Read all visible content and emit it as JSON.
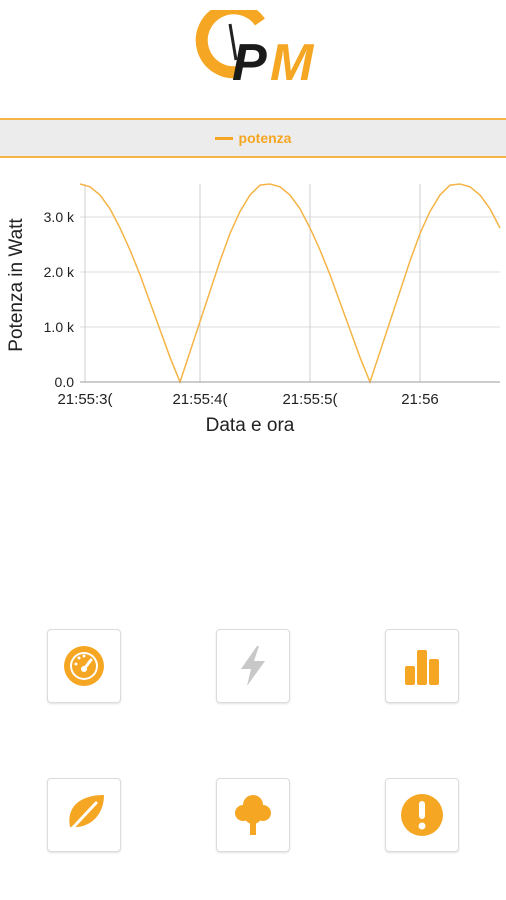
{
  "app": {
    "logo_text": "PM"
  },
  "legend": {
    "label": "potenza"
  },
  "chart_data": {
    "type": "line",
    "xlabel": "Data e ora",
    "ylabel": "Potenza in Watt",
    "x_ticks": [
      "21:55:3(",
      "21:55:4(",
      "21:55:5(",
      "21:56"
    ],
    "y_ticks": [
      "0.0",
      "1.0 k",
      "2.0 k",
      "3.0 k"
    ],
    "ylim": [
      0,
      3600
    ],
    "grid": true,
    "series": [
      {
        "name": "potenza",
        "color": "#f5b445",
        "x_seconds": [
          0,
          1,
          2,
          3,
          4,
          5,
          6,
          7,
          8,
          9,
          10,
          11,
          12,
          13,
          14,
          15,
          16,
          17,
          18,
          19,
          20,
          21,
          22,
          23,
          24,
          25,
          26,
          27,
          28,
          29,
          30,
          31,
          32,
          33,
          34,
          35,
          36,
          37,
          38,
          39,
          40,
          41,
          42
        ],
        "values": [
          3600,
          3550,
          3400,
          3150,
          2800,
          2400,
          1950,
          1450,
          950,
          450,
          0,
          550,
          1100,
          1650,
          2200,
          2700,
          3100,
          3400,
          3580,
          3600,
          3550,
          3400,
          3150,
          2800,
          2400,
          1950,
          1450,
          950,
          450,
          0,
          550,
          1100,
          1650,
          2200,
          2700,
          3100,
          3400,
          3580,
          3600,
          3550,
          3400,
          3150,
          2800
        ]
      }
    ]
  },
  "menu": {
    "tiles": [
      {
        "name": "dashboard-tile",
        "icon": "speedometer-icon",
        "color": "#f5a623"
      },
      {
        "name": "power-tile",
        "icon": "lightning-icon",
        "color": "#c8c8c8"
      },
      {
        "name": "stats-tile",
        "icon": "bar-chart-icon",
        "color": "#f5a623"
      },
      {
        "name": "eco-tile",
        "icon": "leaf-icon",
        "color": "#f5a623"
      },
      {
        "name": "tree-tile",
        "icon": "tree-icon",
        "color": "#f5a623"
      },
      {
        "name": "alert-tile",
        "icon": "alert-icon",
        "color": "#f5a623"
      }
    ]
  }
}
